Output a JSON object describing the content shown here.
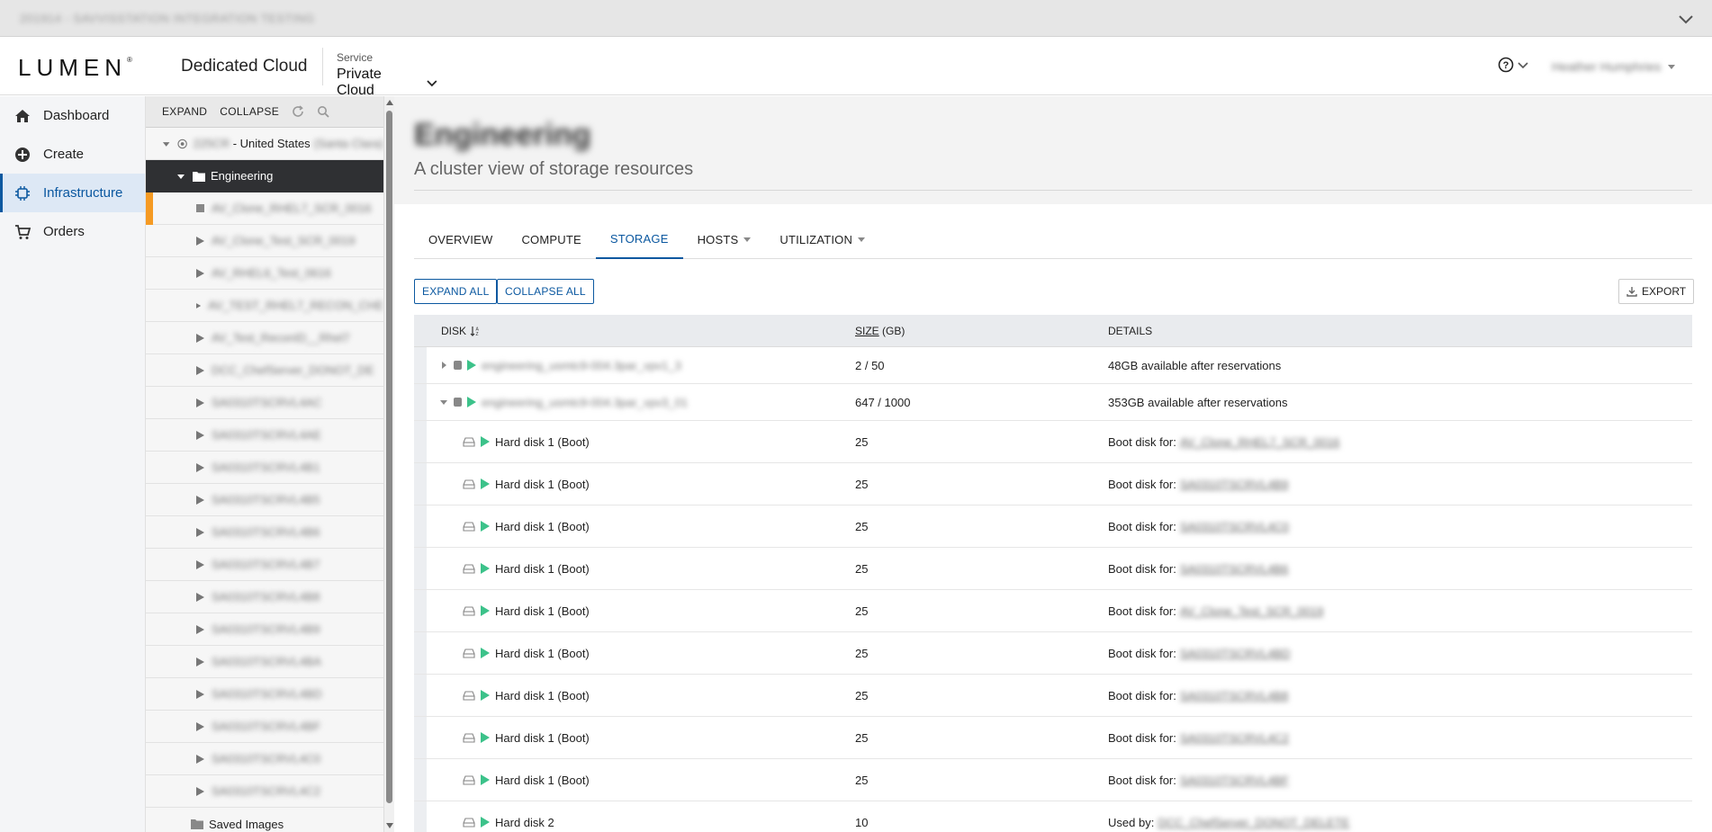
{
  "topbar": {
    "env_label": "201914 - SAVVISSTATION INTEGRATION TESTING"
  },
  "header": {
    "logo": "LUMEN",
    "product": "Dedicated Cloud",
    "service_label": "Service",
    "service_value": "Private Cloud",
    "user_name": "Heather Humphries"
  },
  "nav": [
    {
      "label": "Dashboard",
      "icon": "home-icon"
    },
    {
      "label": "Create",
      "icon": "plus-circle-icon"
    },
    {
      "label": "Infrastructure",
      "icon": "chip-icon"
    },
    {
      "label": "Orders",
      "icon": "cart-icon"
    }
  ],
  "tree": {
    "expand": "EXPAND",
    "collapse": "COLLAPSE",
    "root_id": "225CR",
    "root_suffix": " - United States",
    "root_location": "(Santa Clara)",
    "selected": "Engineering",
    "children": [
      "AV_Clone_RHEL7_SCR_0016",
      "AV_Clone_Test_SCR_0019",
      "AV_RHEL6_Test_0616",
      "AV_TEST_RHEL7_RECON_CHE",
      "AV_Test_ReconID__Rhel7",
      "DCC_ChefServer_DONOT_DE",
      "SA0310TSCRVL4AC",
      "SA0310TSCRVL4AE",
      "SA0310TSCRVL4B1",
      "SA0310TSCRVL4B5",
      "SA0310TSCRVL4B6",
      "SA0310TSCRVL4B7",
      "SA0310TSCRVL4B8",
      "SA0310TSCRVL4B9",
      "SA0310TSCRVL4BA",
      "SA0310TSCRVL4BD",
      "SA0310TSCRVL4BF",
      "SA0310TSCRVL4C0",
      "SA0310TSCRVL4C2"
    ],
    "saved_images": "Saved Images"
  },
  "page": {
    "title": "Engineering",
    "subtitle": "A cluster view of storage resources"
  },
  "tabs": [
    {
      "label": "OVERVIEW",
      "dropdown": false,
      "active": false
    },
    {
      "label": "COMPUTE",
      "dropdown": false,
      "active": false
    },
    {
      "label": "STORAGE",
      "dropdown": false,
      "active": true
    },
    {
      "label": "HOSTS",
      "dropdown": true,
      "active": false
    },
    {
      "label": "UTILIZATION",
      "dropdown": true,
      "active": false
    }
  ],
  "buttons": {
    "expand_all": "EXPAND ALL",
    "collapse_all": "COLLAPSE ALL",
    "export": "EXPORT"
  },
  "table": {
    "headers": {
      "disk": "DISK",
      "size": "SIZE",
      "size_unit": " (GB)",
      "details": "DETAILS"
    },
    "datastores": [
      {
        "name": "engineering_usmtc9-004.3par_vpv1_3",
        "size": "2 / 50",
        "details": "48GB available after reservations",
        "expanded": false
      },
      {
        "name": "engineering_usmtc9-004.3par_vpv3_01",
        "size": "647 / 1000",
        "details": "353GB available after reservations",
        "expanded": true
      }
    ],
    "disks": [
      {
        "name": "Hard disk 1 (Boot)",
        "size": "25",
        "prefix": "Boot disk for:",
        "target": "AV_Clone_RHEL7_SCR_0016"
      },
      {
        "name": "Hard disk 1 (Boot)",
        "size": "25",
        "prefix": "Boot disk for:",
        "target": "SA0310TSCRVL4B9"
      },
      {
        "name": "Hard disk 1 (Boot)",
        "size": "25",
        "prefix": "Boot disk for:",
        "target": "SA0310TSCRVL4C0"
      },
      {
        "name": "Hard disk 1 (Boot)",
        "size": "25",
        "prefix": "Boot disk for:",
        "target": "SA0310TSCRVL4B6"
      },
      {
        "name": "Hard disk 1 (Boot)",
        "size": "25",
        "prefix": "Boot disk for:",
        "target": "AV_Clone_Test_SCR_0019"
      },
      {
        "name": "Hard disk 1 (Boot)",
        "size": "25",
        "prefix": "Boot disk for:",
        "target": "SA0310TSCRVL4BD"
      },
      {
        "name": "Hard disk 1 (Boot)",
        "size": "25",
        "prefix": "Boot disk for:",
        "target": "SA0310TSCRVL4B8"
      },
      {
        "name": "Hard disk 1 (Boot)",
        "size": "25",
        "prefix": "Boot disk for:",
        "target": "SA0310TSCRVL4C2"
      },
      {
        "name": "Hard disk 1 (Boot)",
        "size": "25",
        "prefix": "Boot disk for:",
        "target": "SA0310TSCRVL4BF"
      },
      {
        "name": "Hard disk 2",
        "size": "10",
        "prefix": "Used by:",
        "target": "DCC_ChefServer_DONOT_DELETE"
      }
    ]
  }
}
